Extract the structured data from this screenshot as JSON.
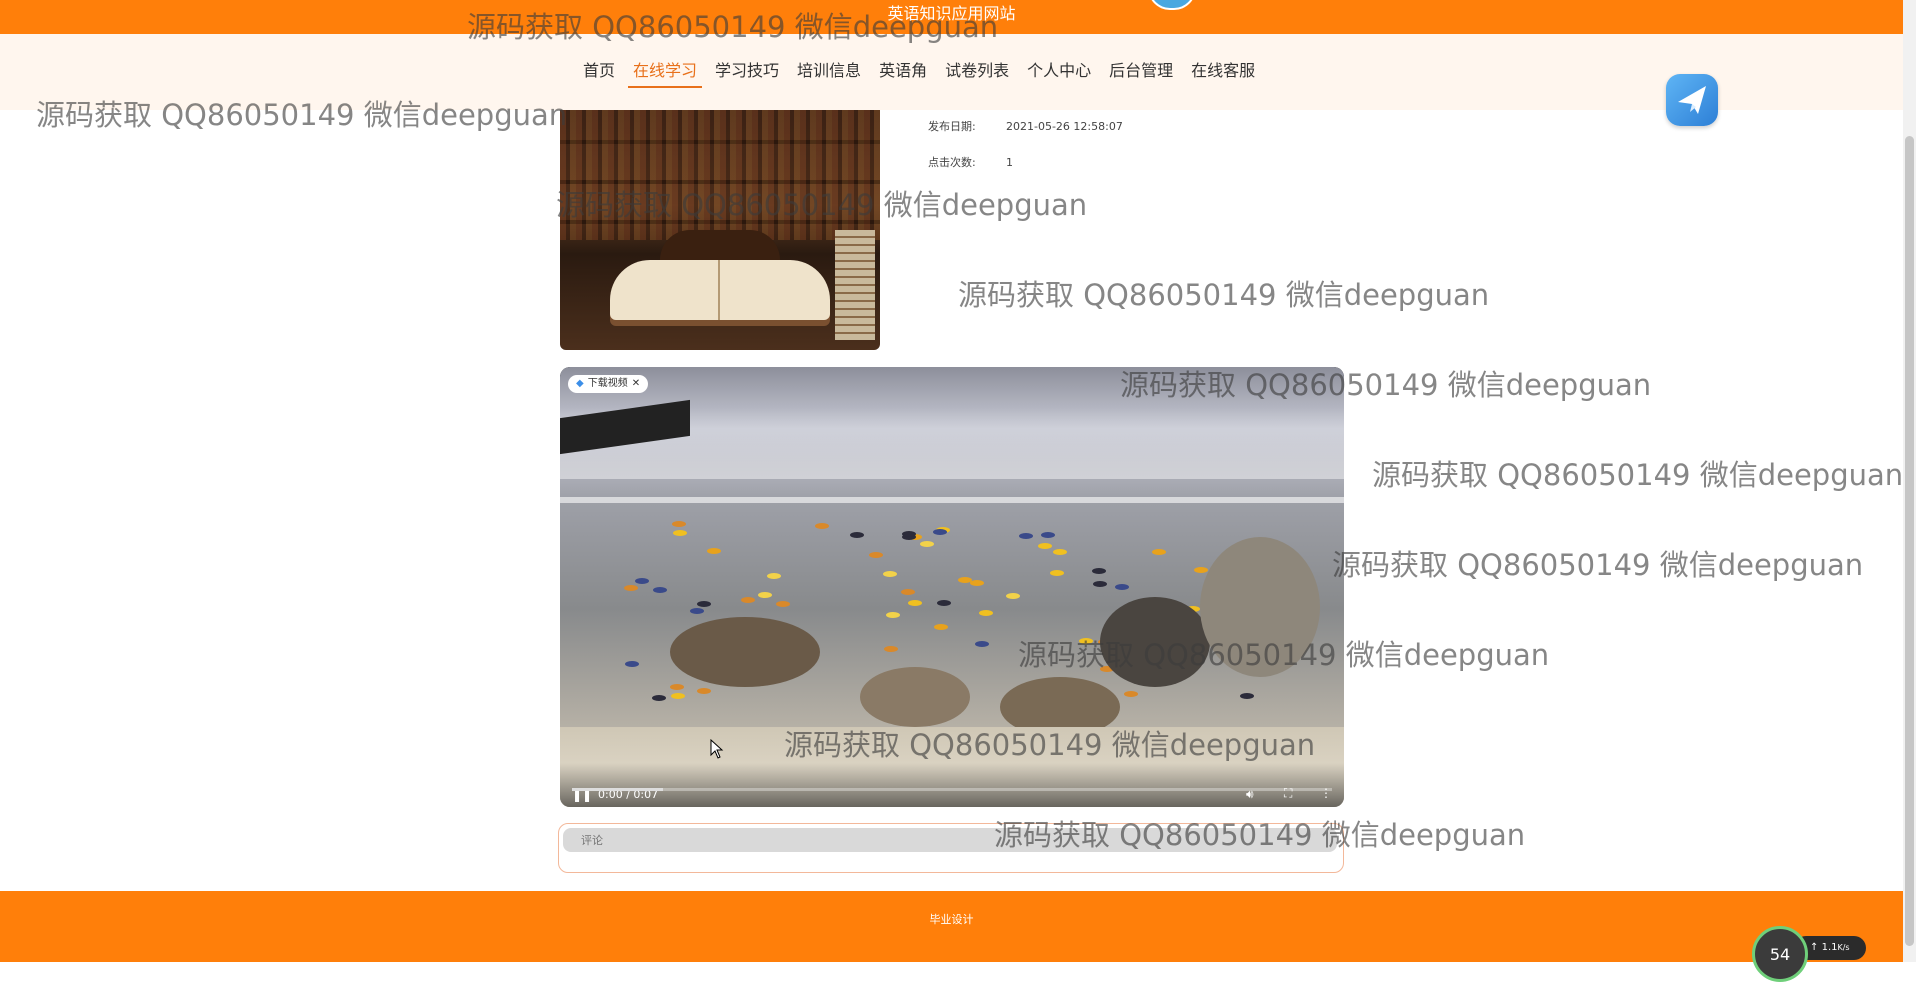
{
  "site": {
    "title": "英语知识应用网站"
  },
  "nav": {
    "items": [
      {
        "label": "首页"
      },
      {
        "label": "在线学习",
        "active": true
      },
      {
        "label": "学习技巧"
      },
      {
        "label": "培训信息"
      },
      {
        "label": "英语角"
      },
      {
        "label": "试卷列表"
      },
      {
        "label": "个人中心"
      },
      {
        "label": "后台管理"
      },
      {
        "label": "在线客服"
      }
    ]
  },
  "detail": {
    "publish_label": "发布日期:",
    "publish_value": "2021-05-26 12:58:07",
    "clicks_label": "点击次数:",
    "clicks_value": "1"
  },
  "video": {
    "download_chip": "下载视频",
    "time": "0:00 / 0:07",
    "progress_fraction": 0.12
  },
  "comment": {
    "placeholder": "评论"
  },
  "footer": {
    "text": "毕业设计"
  },
  "speed": {
    "percent": "54",
    "rate": "1.1",
    "unit": "K/s"
  },
  "watermark": {
    "text": "源码获取 QQ86050149 微信deepguan"
  },
  "colors": {
    "accent": "#ff7f0a",
    "active_nav": "#e8701a"
  }
}
